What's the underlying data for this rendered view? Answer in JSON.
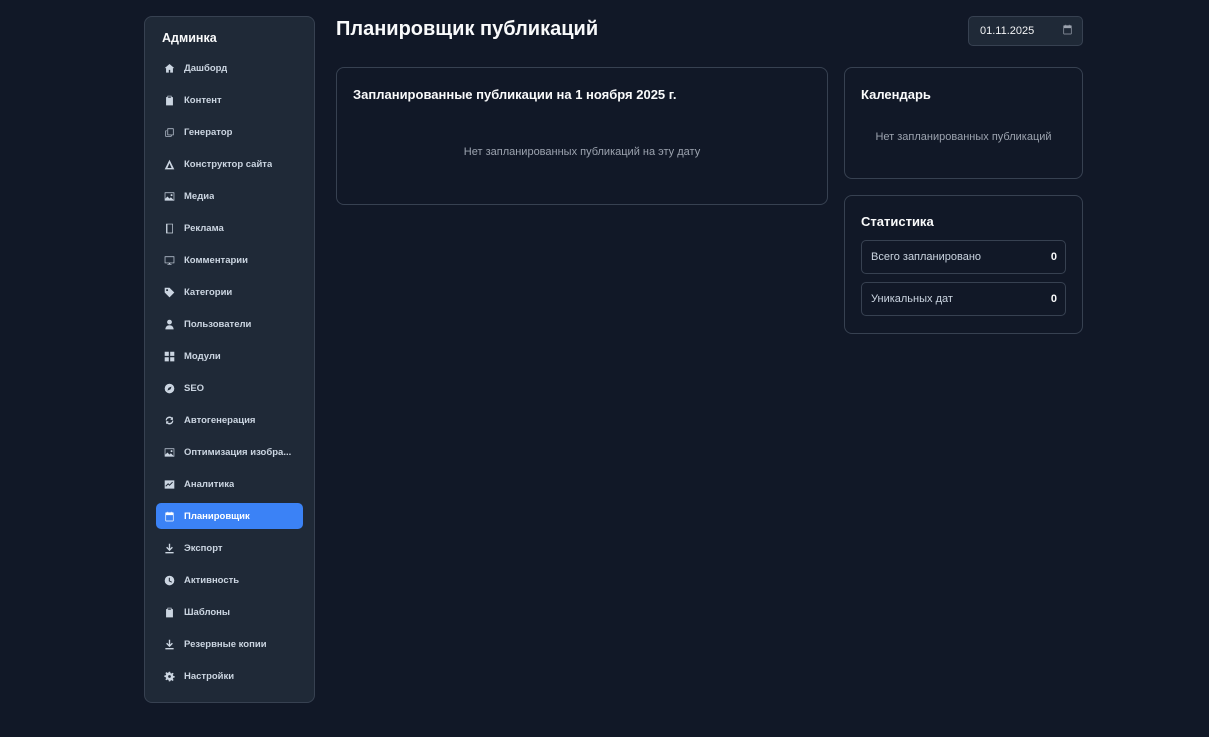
{
  "sidebar": {
    "brand": "Админка",
    "items": [
      {
        "label": "Дашборд",
        "icon": "home-icon"
      },
      {
        "label": "Контент",
        "icon": "clipboard-icon"
      },
      {
        "label": "Генератор",
        "icon": "copy-icon"
      },
      {
        "label": "Конструктор сайта",
        "icon": "triangle-icon"
      },
      {
        "label": "Медиа",
        "icon": "image-icon"
      },
      {
        "label": "Реклама",
        "icon": "book-icon"
      },
      {
        "label": "Комментарии",
        "icon": "monitor-icon"
      },
      {
        "label": "Категории",
        "icon": "tag-icon"
      },
      {
        "label": "Пользователи",
        "icon": "user-icon"
      },
      {
        "label": "Модули",
        "icon": "grid-icon"
      },
      {
        "label": "SEO",
        "icon": "compass-icon"
      },
      {
        "label": "Автогенерация",
        "icon": "refresh-icon"
      },
      {
        "label": "Оптимизация изобра...",
        "icon": "image-icon"
      },
      {
        "label": "Аналитика",
        "icon": "chart-icon"
      },
      {
        "label": "Планировщик",
        "icon": "calendar-icon",
        "active": true
      },
      {
        "label": "Экспорт",
        "icon": "download-icon"
      },
      {
        "label": "Активность",
        "icon": "clock-icon"
      },
      {
        "label": "Шаблоны",
        "icon": "clipboard-icon"
      },
      {
        "label": "Резервные копии",
        "icon": "download-icon"
      },
      {
        "label": "Настройки",
        "icon": "gear-icon"
      }
    ],
    "accent_color": "#3b82f6"
  },
  "header": {
    "title": "Планировщик публикаций",
    "date_value": "01.11.2025"
  },
  "main": {
    "title": "Запланированные публикации на 1 ноября 2025 г.",
    "empty_text": "Нет запланированных публикаций на эту дату"
  },
  "calendar": {
    "title": "Календарь",
    "empty_text": "Нет запланированных публикаций"
  },
  "stats": {
    "title": "Статистика",
    "rows": [
      {
        "label": "Всего запланировано",
        "value": "0"
      },
      {
        "label": "Уникальных дат",
        "value": "0"
      }
    ]
  }
}
